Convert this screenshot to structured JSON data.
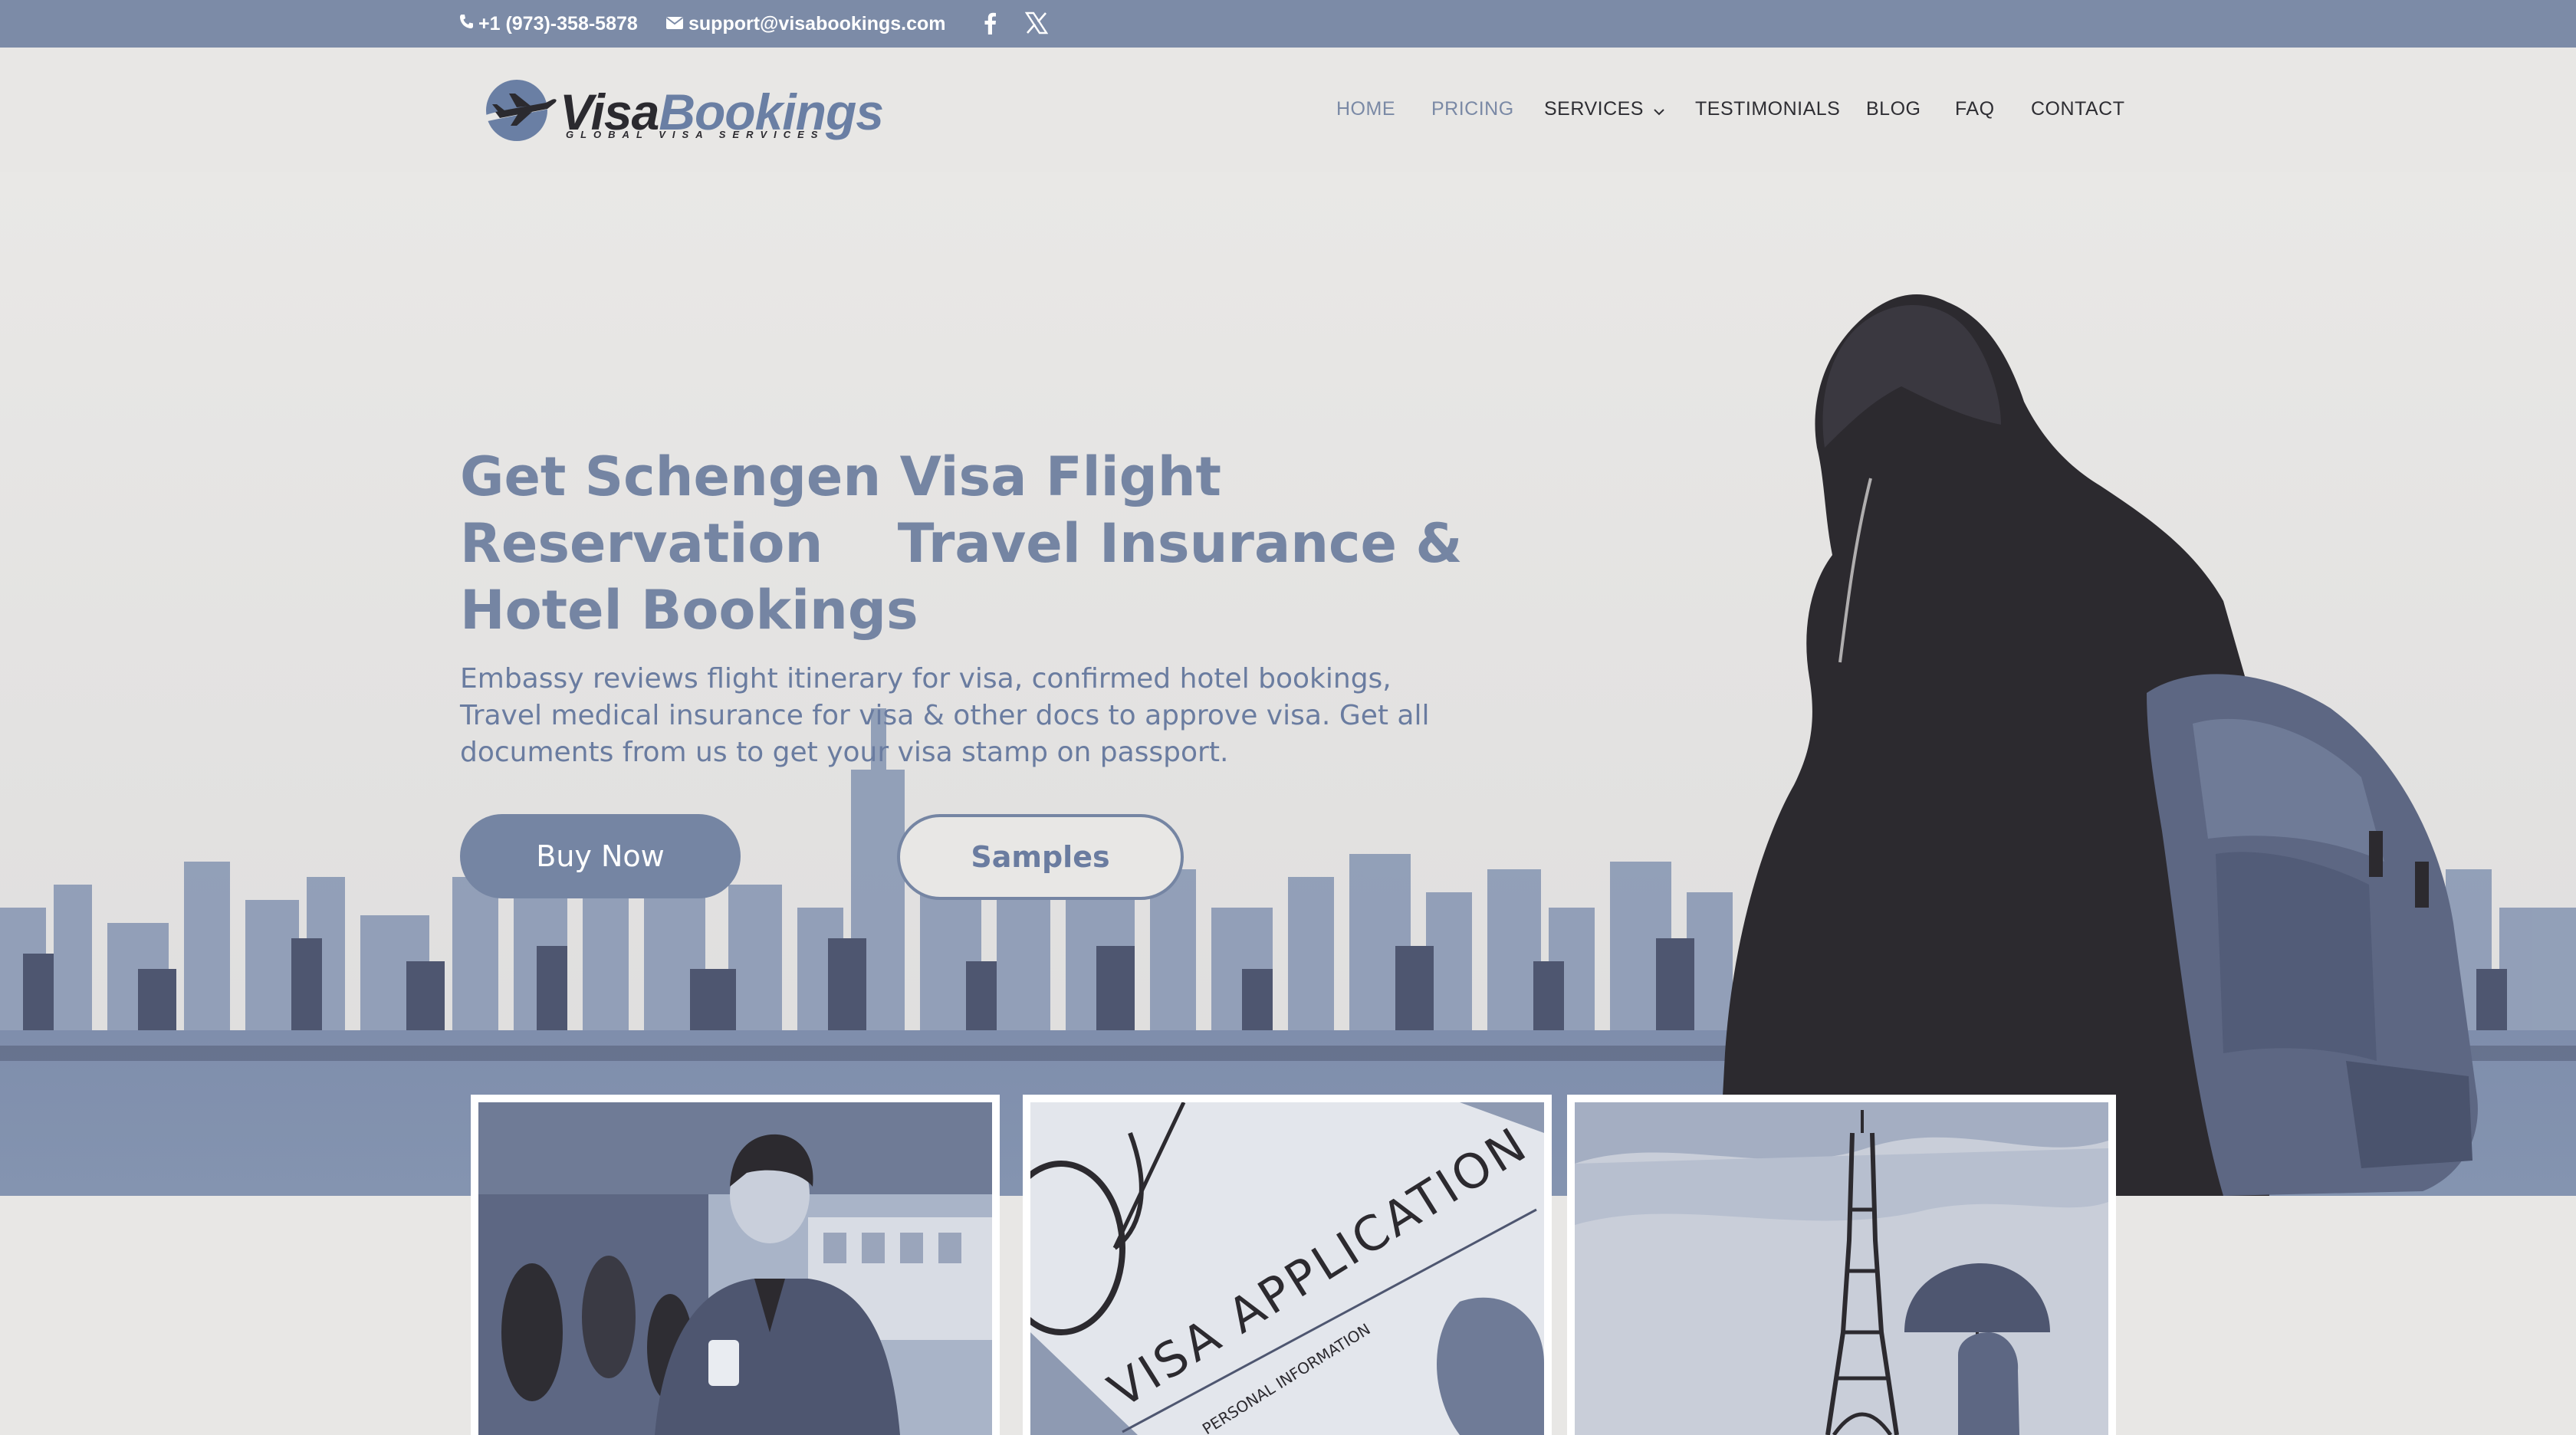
{
  "topbar": {
    "phone": "+1 (973)-358-5878",
    "email": "support@visabookings.com",
    "social": [
      "facebook-icon",
      "x-icon"
    ]
  },
  "logo": {
    "word_a": "Visa",
    "word_b": "Bookings",
    "tagline": "GLOBAL VISA SERVICES"
  },
  "nav": {
    "home": "HOME",
    "pricing": "PRICING",
    "services": "SERVICES",
    "testimonials": "TESTIMONIALS",
    "blog": "BLOG",
    "faq": "FAQ",
    "contact": "CONTACT"
  },
  "hero": {
    "title_line1": "Get Schengen Visa Flight",
    "title_line2": "Reservation    Travel Insurance &",
    "title_line3": "Hotel Bookings",
    "description": "Embassy reviews flight itinerary for visa, confirmed hotel bookings, Travel medical insurance for visa & other docs to approve visa. Get all documents from us to get your visa stamp on passport.",
    "buy_label": "Buy Now",
    "samples_label": "Samples"
  },
  "cards": {
    "card2_text": "VISA APPLICATION",
    "card2_subtext": "PERSONAL INFORMATION"
  },
  "colors": {
    "topbar": "#7c8ba7",
    "accent": "#7585a3",
    "background": "#e8e7e5",
    "dark": "#2b2a2f"
  }
}
